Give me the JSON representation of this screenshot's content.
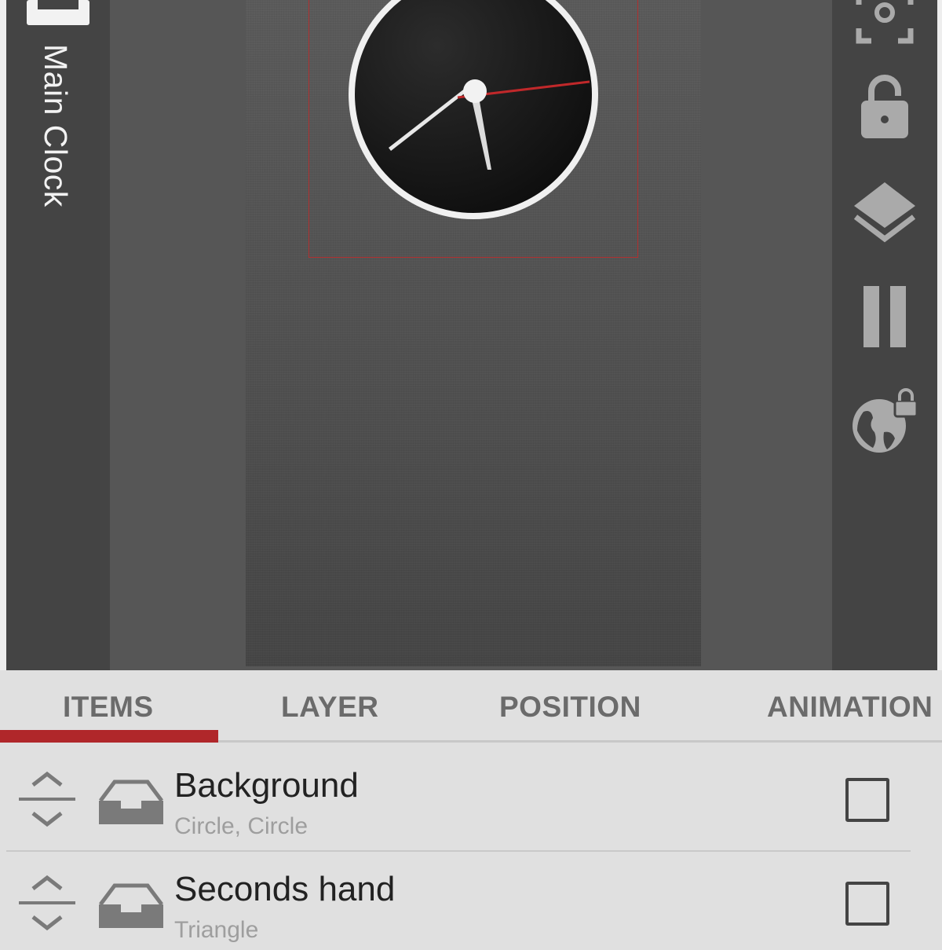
{
  "left_bar": {
    "title": "Main Clock",
    "icon": "inbox-icon"
  },
  "canvas": {
    "accent_color": "#b0272a",
    "clock": {
      "face": "#141414",
      "rim": "#f0f0f0",
      "second_hand": "#c0282a"
    }
  },
  "right_bar": {
    "icons": [
      "focus-frame-icon",
      "unlock-icon",
      "layers-icon",
      "pause-icon",
      "globe-lock-icon"
    ]
  },
  "tabs": [
    {
      "label": "ITEMS",
      "selected": true
    },
    {
      "label": "LAYER",
      "selected": false
    },
    {
      "label": "POSITION",
      "selected": false
    },
    {
      "label": "ANIMATION",
      "selected": false
    }
  ],
  "items": [
    {
      "name": "Background",
      "subtitle": "Circle, Circle",
      "checked": false
    },
    {
      "name": "Seconds hand",
      "subtitle": "Triangle",
      "checked": false
    }
  ]
}
